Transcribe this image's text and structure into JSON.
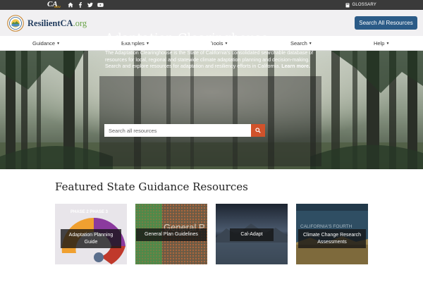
{
  "topbar": {
    "ca_logo_text": "CA",
    "ca_logo_sub": "GOV",
    "glossary_label": "GLOSSARY"
  },
  "header": {
    "brand_name": "ResilientCA",
    "brand_tld": ".org",
    "search_all_label": "Search All Resources"
  },
  "nav": {
    "items": [
      {
        "label": "Guidance"
      },
      {
        "label": "Examples"
      },
      {
        "label": "Tools"
      },
      {
        "label": "Search"
      },
      {
        "label": "Help"
      }
    ]
  },
  "hero": {
    "title": "Adaptation Clearinghouse",
    "description": "The Adaptation Clearinghouse is the State of California's consolidated searchable database of resources for local, regional and statewide climate adaptation planning and decision-making. Search and explore resources for adaptation and resiliency efforts in California.",
    "learn_more": "Learn more.",
    "search_placeholder": "Search all resources"
  },
  "featured": {
    "title": "Featured State Guidance Resources",
    "cards": [
      {
        "label": "Adaptation Planning Guide",
        "image_text": "PHASE 2   PHASE 3"
      },
      {
        "label": "General Plan Guidelines",
        "image_text": "General P"
      },
      {
        "label": "Cal-Adapt",
        "image_text": ""
      },
      {
        "label": "Climate Change Research Assessments",
        "image_text": "CALIFORNIA'S FOURTH"
      }
    ]
  },
  "colors": {
    "topbar": "#3a3a3a",
    "header_bg": "#f1f0f2",
    "primary_button": "#2b5b87",
    "search_button": "#d0522b",
    "brand_blue": "#1f3a5c",
    "brand_green": "#6ba44a"
  }
}
